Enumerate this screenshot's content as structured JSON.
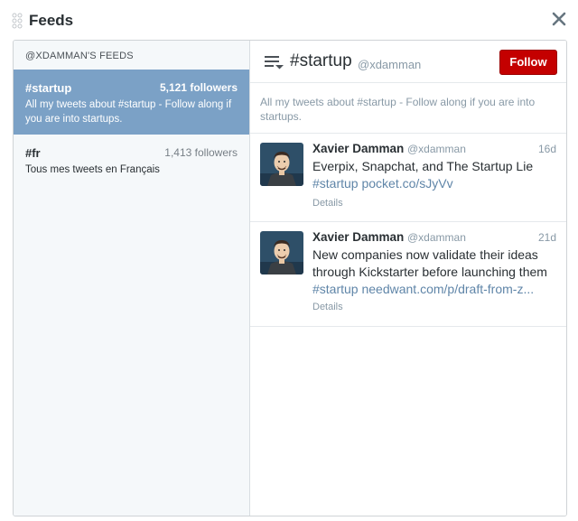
{
  "dialog": {
    "title": "Feeds",
    "close_icon": "close-icon",
    "drag_icon": "drag-handle-icon"
  },
  "sidebar": {
    "heading": "@XDAMMAN'S FEEDS",
    "items": [
      {
        "name": "#startup",
        "followers": "5,121 followers",
        "description": "All my tweets about #startup - Follow along if you are into startups.",
        "selected": true
      },
      {
        "name": "#fr",
        "followers": "1,413 followers",
        "description": "Tous mes tweets en Français",
        "selected": false
      }
    ]
  },
  "main": {
    "title": "#startup",
    "owner": "@xdamman",
    "follow_label": "Follow",
    "description": "All my tweets about #startup - Follow along if you are into startups.",
    "tweets": [
      {
        "name": "Xavier Damman",
        "handle": "@xdamman",
        "time": "16d",
        "text": "Everpix, Snapchat, and The Startup Lie",
        "hashtag": "#startup",
        "link": "pocket.co/sJyVv",
        "details": "Details"
      },
      {
        "name": "Xavier Damman",
        "handle": "@xdamman",
        "time": "21d",
        "text": "New companies now validate their ideas through Kickstarter before launching them",
        "hashtag": "#startup",
        "link": "needwant.com/p/draft-from-z...",
        "details": "Details"
      }
    ]
  },
  "colors": {
    "selected_feed_bg": "#7ba1c6",
    "follow_button": "#c40000",
    "link": "#5f85a8",
    "muted_text": "#8899a6"
  }
}
